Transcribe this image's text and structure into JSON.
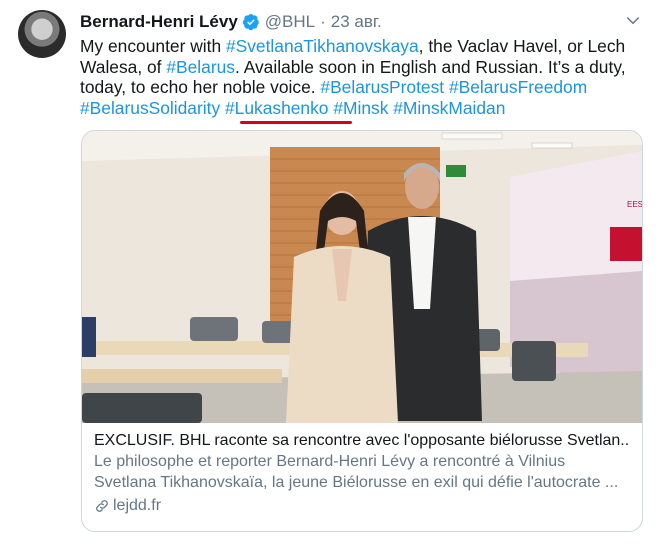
{
  "tweet": {
    "author_name": "Bernard-Henri Lévy",
    "handle": "@BHL",
    "separator": "·",
    "date": "23 авг.",
    "text": {
      "p1": "My encounter with ",
      "tag1": "#SvetlanaTikhanovskaya",
      "p2": ", the Vaclav Havel, or Lech Walesa, of ",
      "tag2": "#Belarus",
      "p3": ". Available soon in English and Russian. It’s a duty, today, to echo her noble voice. ",
      "tag3": "#BelarusProtest",
      "tag4": "#BelarusFreedom",
      "tag5": "#BelarusSolidarity",
      "tag6": "#Lukashenko",
      "tag7": "#Minsk",
      "tag8": "#MinskMaidan"
    }
  },
  "card": {
    "title": "EXCLUSIF. BHL raconte sa rencontre avec l'opposante biélorusse Svetlan...",
    "description": "Le philosophe et reporter Bernard-Henri Lévy a rencontré à Vilnius Svetlana Tikhanovskaïa, la jeune Biélorusse en exil qui défie l'autocrate ...",
    "domain": "lejdd.fr",
    "sign_text": "EESC"
  },
  "icons": {
    "verified": "verified-badge-icon",
    "menu": "chevron-down-icon",
    "link": "link-icon"
  },
  "colors": {
    "link": "#1b95e0",
    "annotation_underline": "#d6001a",
    "secondary_text": "#657786",
    "verified": "#1da1f2"
  }
}
